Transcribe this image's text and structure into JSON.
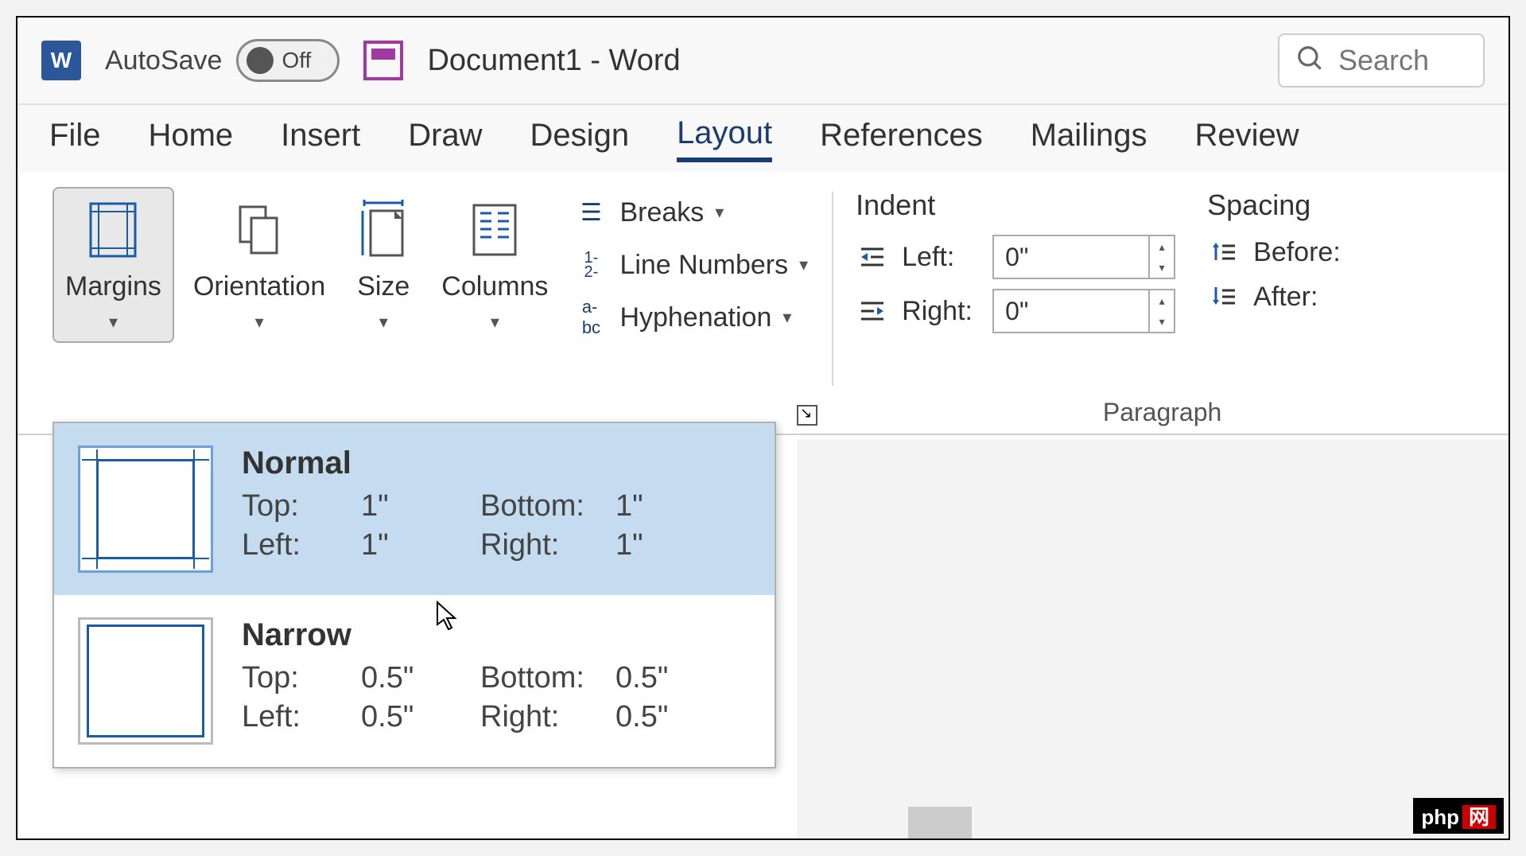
{
  "titlebar": {
    "autosave_label": "AutoSave",
    "autosave_state": "Off",
    "doc_title": "Document1  -  Word",
    "search_placeholder": "Search"
  },
  "tabs": [
    "File",
    "Home",
    "Insert",
    "Draw",
    "Design",
    "Layout",
    "References",
    "Mailings",
    "Review"
  ],
  "active_tab": "Layout",
  "ribbon": {
    "page_setup": {
      "margins": "Margins",
      "orientation": "Orientation",
      "size": "Size",
      "columns": "Columns",
      "breaks": "Breaks",
      "line_numbers": "Line Numbers",
      "hyphenation": "Hyphenation"
    },
    "paragraph": {
      "indent_label": "Indent",
      "left_label": "Left:",
      "right_label": "Right:",
      "left_val": "0\"",
      "right_val": "0\"",
      "spacing_label": "Spacing",
      "before_label": "Before:",
      "after_label": "After:",
      "caption": "Paragraph"
    }
  },
  "margins_menu": {
    "items": [
      {
        "name": "Normal",
        "top_label": "Top:",
        "top_val": "1\"",
        "bottom_label": "Bottom:",
        "bottom_val": "1\"",
        "left_label": "Left:",
        "left_val": "1\"",
        "right_label": "Right:",
        "right_val": "1\""
      },
      {
        "name": "Narrow",
        "top_label": "Top:",
        "top_val": "0.5\"",
        "bottom_label": "Bottom:",
        "bottom_val": "0.5\"",
        "left_label": "Left:",
        "left_val": "0.5\"",
        "right_label": "Right:",
        "right_val": "0.5\""
      }
    ]
  },
  "watermark": {
    "text1": "php",
    "text2": "网"
  }
}
